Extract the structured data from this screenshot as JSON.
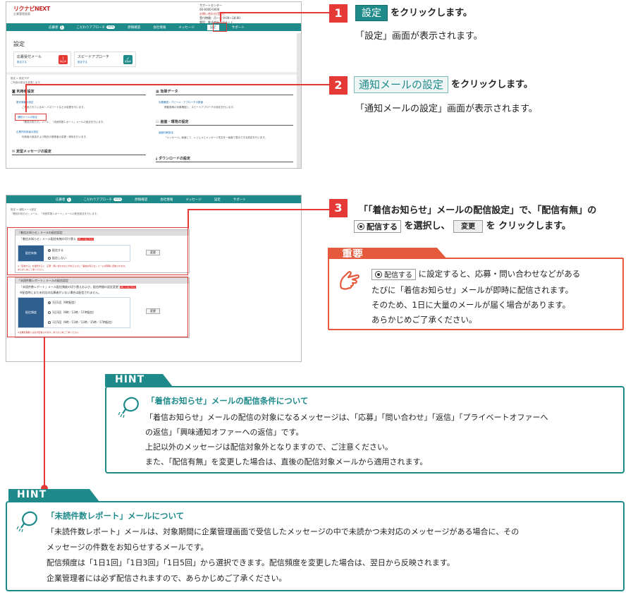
{
  "shot1": {
    "brand": "リクナビNEXT",
    "brand_sub": "企業管理画面",
    "support": {
      "title": "サポートセンター",
      "line1": "00-0000-0000",
      "line2": "お問い合わせ(受付)",
      "line3": "受付時間：月〜金 9:00〜18:00",
      "line4": "電話：株式会社リクルート"
    },
    "nav": [
      "応募者",
      "こだわりアプローチ",
      "原稿確認",
      "会社情報",
      "メッセージ",
      "設定",
      "サポート"
    ],
    "nav_badge": "1",
    "nav_pill": "NEW",
    "page_title": "設定",
    "cards": [
      {
        "title": "応募受付メール",
        "sub": "設定する",
        "icon": "!",
        "icon_sub": "停止中"
      },
      {
        "title": "スピードアプローチ",
        "sub": "設定する",
        "icon": "✓",
        "icon_sub": "配信中"
      }
    ],
    "crumb": "設定 > 設定TOP",
    "crumb2": "ご利用の設定を変更します。",
    "sections": {
      "basic": "利用者設定",
      "basic_link1": "基本情報の設定",
      "basic_desc1": "ご利用されているID・パスワードなどの変更を行います。",
      "basic_link2": "通知メールの設定",
      "basic_desc2": "「着信お知らせ」メール、「未読件数レポート」メールの設定を行います。",
      "basic_link3": "企業内利用者の設定",
      "basic_desc3": "利用者の追加および既存の登録者の変更・削除を行います。",
      "message": "定型メッセージの設定",
      "effect": "効果データ",
      "effect_link": "効果確認・アピール・アプローチの数値",
      "effect_desc": "掲載原稿の効果確認と、スピードアプローチの設定を行います。",
      "display": "画面・環境の設定",
      "display_link": "画面印刷設定",
      "display_desc": "「メッセージ」画面にて、レジュメとメッセージ本文を一画面で表示できる設定を行います。",
      "download": "ダウンロードの設定"
    }
  },
  "step1": {
    "num": "1",
    "button": "設定",
    "action": "をクリックします。",
    "result": "「設定」画面が表示されます。"
  },
  "step2": {
    "num": "2",
    "button": "通知メールの設定",
    "action": "をクリックします。",
    "result": "「通知メールの設定」画面が表示されます。"
  },
  "step3": {
    "num": "3",
    "line1": "「「着信お知らせ」メールの配信設定」で、「配信有無」の",
    "radio": "配信する",
    "line2a": "を選択し、",
    "button": "変更",
    "line2b": "を クリックします。"
  },
  "shot2": {
    "nav": [
      "応募者",
      "こだわりアプローチ",
      "原稿確認",
      "会社情報",
      "メッセージ",
      "設定",
      "サポート"
    ],
    "crumb": "設定 > 通知メール設定",
    "crumb2": "「着信お知らせ」メール、「未読件数レポート」メールの配信設定を行います。",
    "sec1_head": "「着信お知らせ」メールの配信設定",
    "sec1_q": "「着信お知らせ」メール配信有無の切り替え",
    "sec1_label": "配信有無",
    "sec1_opt1": "配信する",
    "sec1_opt2": "配信しない",
    "sec1_note": "※「配信する」を選択すると、応募・問い合わせなどがあるたびに「着信お知らせ」メールが即時に配信されます。",
    "sec1_note2": "あらかじめご了承ください。",
    "sec2_head": "「未読件数レポート」メールの配信設定",
    "sec2_q": "「未読件数レポート」メール配信頻度の切り替えおよび、配信時間の設定変更",
    "sec2_q2": "※配信時にまだ未対応の応募者がいない場合は配信されません。",
    "sec2_label": "配信頻度",
    "sec2_opt1": "1日1回（9時配信）",
    "sec2_opt2": "1日3回（9時／13時／17時配信）",
    "sec2_opt3": "1日5回（9時／11時／13時／15時／17時配信）",
    "sec2_note": "※企業管理者には必ず配信されます。あらかじめご了承ください。",
    "badge": "詳しくはこちら",
    "change": "変更"
  },
  "important": {
    "title": "重要",
    "radio": "配信する",
    "line1": "に設定すると、応募・問い合わせなどがある",
    "line2": "たびに「着信お知らせ」メールが即時に配信されます。",
    "line3": "そのため、1日に大量のメールが届く場合があります。",
    "line4": "あらかじめご了承ください。"
  },
  "hint1": {
    "label": "HINT",
    "title": "「着信お知らせ」メールの配信条件について",
    "line1": "「着信お知らせ」メールの配信の対象になるメッセージは、「応募」「問い合わせ」「返信」「プライベートオファーへ",
    "line2": "の返信」「興味通知オファーへの返信」です。",
    "line3": "上記以外のメッセージは配信対象外となりますので、ご注意ください。",
    "line4": "また、「配信有無」を変更した場合は、直後の配信対象メールから適用されます。"
  },
  "hint2": {
    "label": "HINT",
    "title": "「未読件数レポート」メールについて",
    "line1": "「未読件数レポート」メールは、対象期間に企業管理画面で受信したメッセージの中で未読かつ未対応のメッセージがある場合に、その",
    "line2": "メッセージの件数をお知らせするメールです。",
    "line3": "配信頻度は「1日1回」「1日3回」「1日5回」から選択できます。配信頻度を変更した場合は、翌日から反映されます。",
    "line4": "企業管理者には必ず配信されますので、あらかじめご了承ください。"
  },
  "colors": {
    "teal": "#1e8a8a",
    "red": "#e53935",
    "orange": "#e55a3c"
  }
}
